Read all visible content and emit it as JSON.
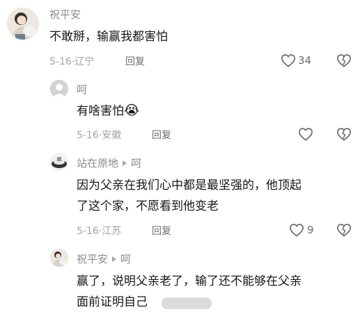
{
  "comments": [
    {
      "user": "祝平安",
      "text": "不敢掰，输赢我都害怕",
      "date": "5-16",
      "location": "辽宁",
      "reply_label": "回复",
      "likes": "34"
    },
    {
      "user": "呵",
      "text": "有啥害怕",
      "emoji": "😭",
      "date": "5-16",
      "location": "安徽",
      "reply_label": "回复",
      "likes": ""
    },
    {
      "user": "站在原地",
      "reply_to": "呵",
      "text_line1": "因为父亲在我们心中都是最坚强的，他顶起",
      "text_line2": "了这个家，不愿看到他变老",
      "date": "5-16",
      "location": "江苏",
      "reply_label": "回复",
      "likes": "9"
    },
    {
      "user": "祝平安",
      "reply_to": "呵",
      "text_line1": "赢了，说明父亲老了，输了还不能够在父亲",
      "text_line2": "面前证明自己"
    }
  ],
  "colors": {
    "name": "#8a8a8a",
    "text": "#161616",
    "meta": "#a3a3a3",
    "icon": "#6d6d6d"
  }
}
